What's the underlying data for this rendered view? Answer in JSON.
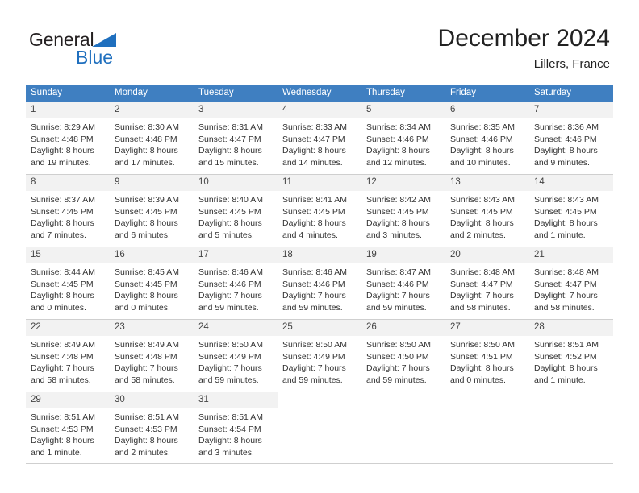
{
  "brand": {
    "name_part1": "General",
    "name_part2": "Blue",
    "triangle_color": "#1f6fbe"
  },
  "header": {
    "title": "December 2024",
    "subtitle": "Lillers, France"
  },
  "colors": {
    "header_row_bg": "#3f7fc1",
    "daynum_bg": "#f2f2f2",
    "grid_line": "#cfcfcf",
    "text": "#333333"
  },
  "weekday_headers": [
    "Sunday",
    "Monday",
    "Tuesday",
    "Wednesday",
    "Thursday",
    "Friday",
    "Saturday"
  ],
  "weeks": [
    [
      {
        "day": "1",
        "sunrise": "Sunrise: 8:29 AM",
        "sunset": "Sunset: 4:48 PM",
        "daylight1": "Daylight: 8 hours",
        "daylight2": "and 19 minutes."
      },
      {
        "day": "2",
        "sunrise": "Sunrise: 8:30 AM",
        "sunset": "Sunset: 4:48 PM",
        "daylight1": "Daylight: 8 hours",
        "daylight2": "and 17 minutes."
      },
      {
        "day": "3",
        "sunrise": "Sunrise: 8:31 AM",
        "sunset": "Sunset: 4:47 PM",
        "daylight1": "Daylight: 8 hours",
        "daylight2": "and 15 minutes."
      },
      {
        "day": "4",
        "sunrise": "Sunrise: 8:33 AM",
        "sunset": "Sunset: 4:47 PM",
        "daylight1": "Daylight: 8 hours",
        "daylight2": "and 14 minutes."
      },
      {
        "day": "5",
        "sunrise": "Sunrise: 8:34 AM",
        "sunset": "Sunset: 4:46 PM",
        "daylight1": "Daylight: 8 hours",
        "daylight2": "and 12 minutes."
      },
      {
        "day": "6",
        "sunrise": "Sunrise: 8:35 AM",
        "sunset": "Sunset: 4:46 PM",
        "daylight1": "Daylight: 8 hours",
        "daylight2": "and 10 minutes."
      },
      {
        "day": "7",
        "sunrise": "Sunrise: 8:36 AM",
        "sunset": "Sunset: 4:46 PM",
        "daylight1": "Daylight: 8 hours",
        "daylight2": "and 9 minutes."
      }
    ],
    [
      {
        "day": "8",
        "sunrise": "Sunrise: 8:37 AM",
        "sunset": "Sunset: 4:45 PM",
        "daylight1": "Daylight: 8 hours",
        "daylight2": "and 7 minutes."
      },
      {
        "day": "9",
        "sunrise": "Sunrise: 8:39 AM",
        "sunset": "Sunset: 4:45 PM",
        "daylight1": "Daylight: 8 hours",
        "daylight2": "and 6 minutes."
      },
      {
        "day": "10",
        "sunrise": "Sunrise: 8:40 AM",
        "sunset": "Sunset: 4:45 PM",
        "daylight1": "Daylight: 8 hours",
        "daylight2": "and 5 minutes."
      },
      {
        "day": "11",
        "sunrise": "Sunrise: 8:41 AM",
        "sunset": "Sunset: 4:45 PM",
        "daylight1": "Daylight: 8 hours",
        "daylight2": "and 4 minutes."
      },
      {
        "day": "12",
        "sunrise": "Sunrise: 8:42 AM",
        "sunset": "Sunset: 4:45 PM",
        "daylight1": "Daylight: 8 hours",
        "daylight2": "and 3 minutes."
      },
      {
        "day": "13",
        "sunrise": "Sunrise: 8:43 AM",
        "sunset": "Sunset: 4:45 PM",
        "daylight1": "Daylight: 8 hours",
        "daylight2": "and 2 minutes."
      },
      {
        "day": "14",
        "sunrise": "Sunrise: 8:43 AM",
        "sunset": "Sunset: 4:45 PM",
        "daylight1": "Daylight: 8 hours",
        "daylight2": "and 1 minute."
      }
    ],
    [
      {
        "day": "15",
        "sunrise": "Sunrise: 8:44 AM",
        "sunset": "Sunset: 4:45 PM",
        "daylight1": "Daylight: 8 hours",
        "daylight2": "and 0 minutes."
      },
      {
        "day": "16",
        "sunrise": "Sunrise: 8:45 AM",
        "sunset": "Sunset: 4:45 PM",
        "daylight1": "Daylight: 8 hours",
        "daylight2": "and 0 minutes."
      },
      {
        "day": "17",
        "sunrise": "Sunrise: 8:46 AM",
        "sunset": "Sunset: 4:46 PM",
        "daylight1": "Daylight: 7 hours",
        "daylight2": "and 59 minutes."
      },
      {
        "day": "18",
        "sunrise": "Sunrise: 8:46 AM",
        "sunset": "Sunset: 4:46 PM",
        "daylight1": "Daylight: 7 hours",
        "daylight2": "and 59 minutes."
      },
      {
        "day": "19",
        "sunrise": "Sunrise: 8:47 AM",
        "sunset": "Sunset: 4:46 PM",
        "daylight1": "Daylight: 7 hours",
        "daylight2": "and 59 minutes."
      },
      {
        "day": "20",
        "sunrise": "Sunrise: 8:48 AM",
        "sunset": "Sunset: 4:47 PM",
        "daylight1": "Daylight: 7 hours",
        "daylight2": "and 58 minutes."
      },
      {
        "day": "21",
        "sunrise": "Sunrise: 8:48 AM",
        "sunset": "Sunset: 4:47 PM",
        "daylight1": "Daylight: 7 hours",
        "daylight2": "and 58 minutes."
      }
    ],
    [
      {
        "day": "22",
        "sunrise": "Sunrise: 8:49 AM",
        "sunset": "Sunset: 4:48 PM",
        "daylight1": "Daylight: 7 hours",
        "daylight2": "and 58 minutes."
      },
      {
        "day": "23",
        "sunrise": "Sunrise: 8:49 AM",
        "sunset": "Sunset: 4:48 PM",
        "daylight1": "Daylight: 7 hours",
        "daylight2": "and 58 minutes."
      },
      {
        "day": "24",
        "sunrise": "Sunrise: 8:50 AM",
        "sunset": "Sunset: 4:49 PM",
        "daylight1": "Daylight: 7 hours",
        "daylight2": "and 59 minutes."
      },
      {
        "day": "25",
        "sunrise": "Sunrise: 8:50 AM",
        "sunset": "Sunset: 4:49 PM",
        "daylight1": "Daylight: 7 hours",
        "daylight2": "and 59 minutes."
      },
      {
        "day": "26",
        "sunrise": "Sunrise: 8:50 AM",
        "sunset": "Sunset: 4:50 PM",
        "daylight1": "Daylight: 7 hours",
        "daylight2": "and 59 minutes."
      },
      {
        "day": "27",
        "sunrise": "Sunrise: 8:50 AM",
        "sunset": "Sunset: 4:51 PM",
        "daylight1": "Daylight: 8 hours",
        "daylight2": "and 0 minutes."
      },
      {
        "day": "28",
        "sunrise": "Sunrise: 8:51 AM",
        "sunset": "Sunset: 4:52 PM",
        "daylight1": "Daylight: 8 hours",
        "daylight2": "and 1 minute."
      }
    ],
    [
      {
        "day": "29",
        "sunrise": "Sunrise: 8:51 AM",
        "sunset": "Sunset: 4:53 PM",
        "daylight1": "Daylight: 8 hours",
        "daylight2": "and 1 minute."
      },
      {
        "day": "30",
        "sunrise": "Sunrise: 8:51 AM",
        "sunset": "Sunset: 4:53 PM",
        "daylight1": "Daylight: 8 hours",
        "daylight2": "and 2 minutes."
      },
      {
        "day": "31",
        "sunrise": "Sunrise: 8:51 AM",
        "sunset": "Sunset: 4:54 PM",
        "daylight1": "Daylight: 8 hours",
        "daylight2": "and 3 minutes."
      },
      {
        "day": "",
        "sunrise": "",
        "sunset": "",
        "daylight1": "",
        "daylight2": ""
      },
      {
        "day": "",
        "sunrise": "",
        "sunset": "",
        "daylight1": "",
        "daylight2": ""
      },
      {
        "day": "",
        "sunrise": "",
        "sunset": "",
        "daylight1": "",
        "daylight2": ""
      },
      {
        "day": "",
        "sunrise": "",
        "sunset": "",
        "daylight1": "",
        "daylight2": ""
      }
    ]
  ]
}
